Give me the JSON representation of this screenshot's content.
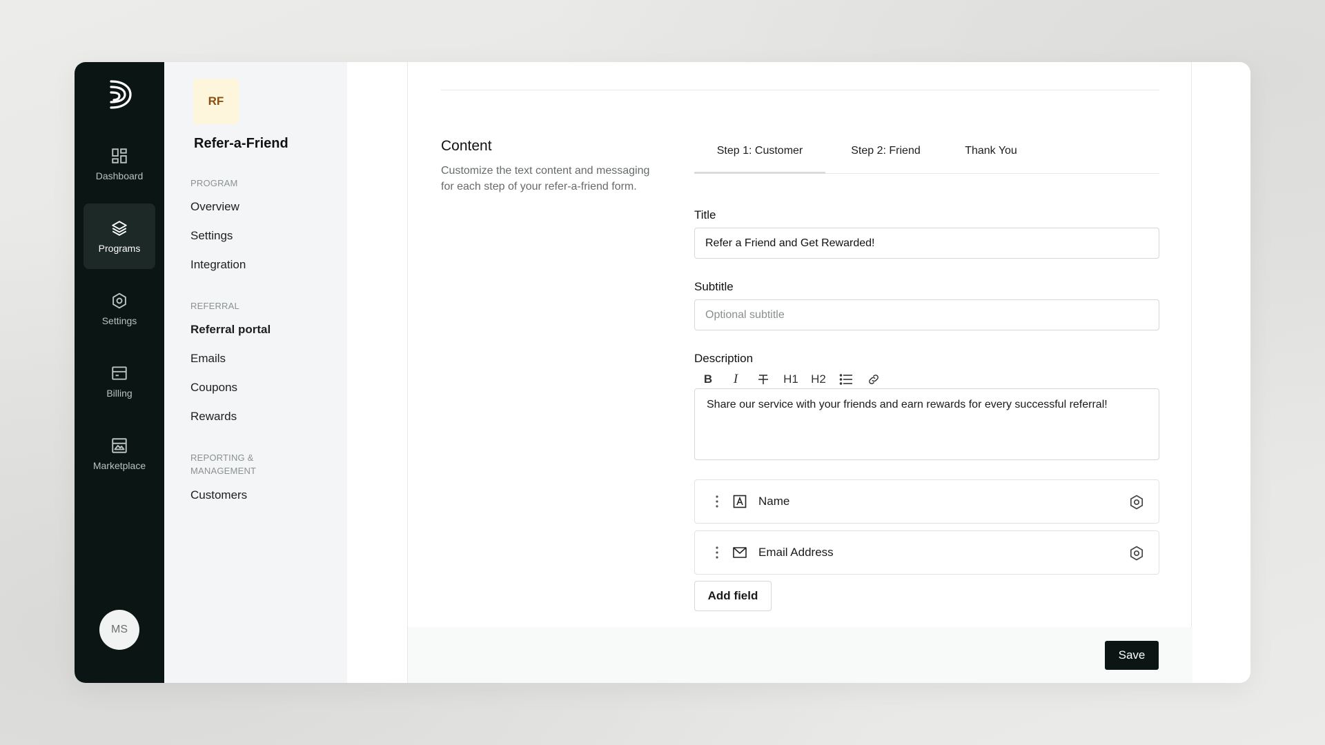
{
  "rail": {
    "items": [
      {
        "label": "Dashboard",
        "icon": "dashboard-icon"
      },
      {
        "label": "Programs",
        "icon": "layers-icon"
      },
      {
        "label": "Settings",
        "icon": "gear-icon"
      },
      {
        "label": "Billing",
        "icon": "billing-icon"
      },
      {
        "label": "Marketplace",
        "icon": "marketplace-icon"
      }
    ],
    "avatar": "MS"
  },
  "program": {
    "badge": "RF",
    "name": "Refer-a-Friend",
    "sections": [
      {
        "heading": "PROGRAM",
        "links": [
          "Overview",
          "Settings",
          "Integration"
        ]
      },
      {
        "heading": "REFERRAL",
        "links": [
          "Referral portal",
          "Emails",
          "Coupons",
          "Rewards"
        ]
      },
      {
        "heading": "REPORTING &",
        "heading2": "MANAGEMENT",
        "links": [
          "Customers"
        ]
      }
    ]
  },
  "content": {
    "title": "Content",
    "description": "Customize the text content and messaging for each step of your refer-a-friend form.",
    "tabs": [
      "Step 1: Customer",
      "Step 2: Friend",
      "Thank You"
    ],
    "title_label": "Title",
    "title_value": "Refer a Friend and Get Rewarded!",
    "subtitle_label": "Subtitle",
    "subtitle_placeholder": "Optional subtitle",
    "description_label": "Description",
    "toolbar": {
      "bold": "B",
      "italic": "I",
      "h1": "H1",
      "h2": "H2"
    },
    "description_value": "Share our service with your friends and earn rewards for every successful referral!",
    "fields": [
      "Name",
      "Email Address"
    ],
    "add_field_label": "Add field",
    "save_label": "Save"
  }
}
